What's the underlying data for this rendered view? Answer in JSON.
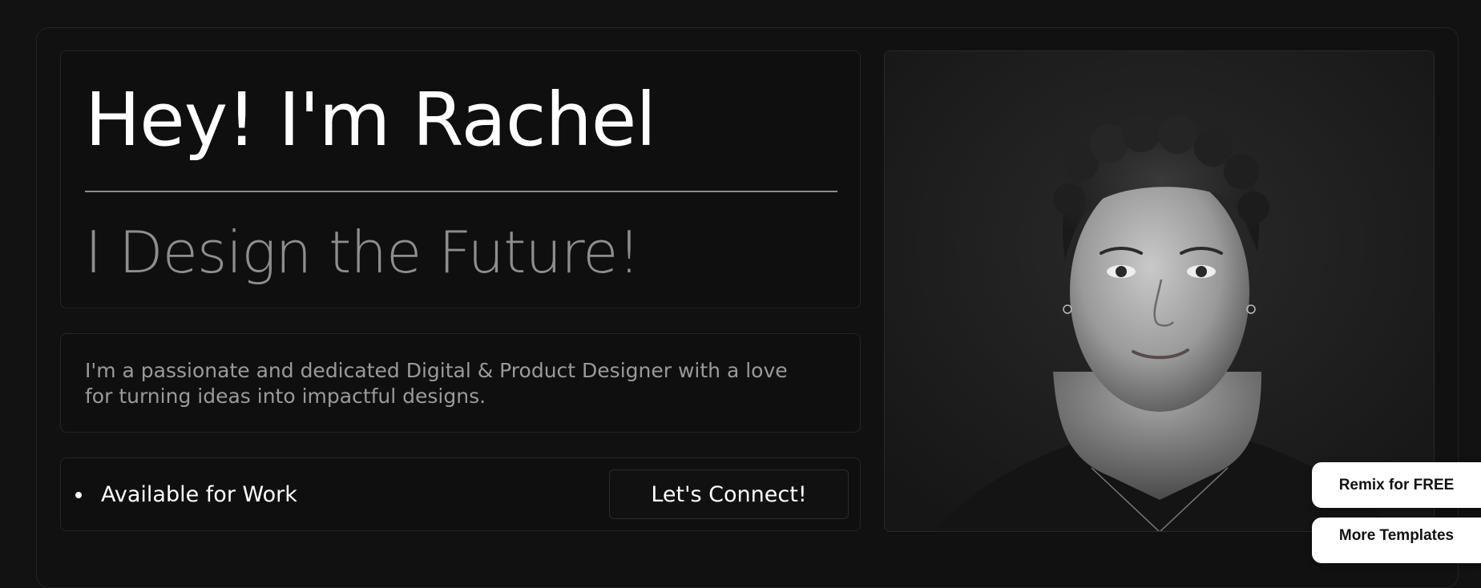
{
  "hero": {
    "title": "Hey! I'm Rachel",
    "subtitle": "I Design the Future!"
  },
  "about": {
    "text": "I'm a passionate and dedicated Digital & Product Designer with a love for turning ideas into impactful designs."
  },
  "status": {
    "label": "Available for Work",
    "connect_label": "Let's Connect!"
  },
  "floating": {
    "remix_label": "Remix for FREE",
    "templates_label": "More Templates"
  },
  "colors": {
    "background": "#121212",
    "card": "#0f0f0f",
    "title": "#ffffff",
    "subtitle": "#8e8e8e",
    "body_text": "#9a9a9a"
  },
  "icons": {
    "status_marker": "bullet-dot-icon"
  }
}
